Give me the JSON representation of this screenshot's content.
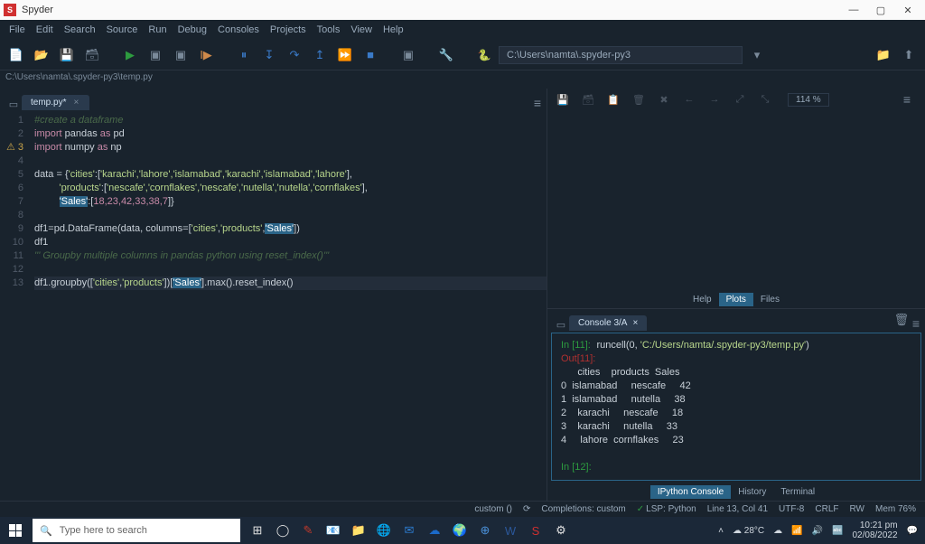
{
  "window": {
    "title": "Spyder",
    "min": "—",
    "max": "▢",
    "close": "✕"
  },
  "menu": [
    "File",
    "Edit",
    "Search",
    "Source",
    "Run",
    "Debug",
    "Consoles",
    "Projects",
    "Tools",
    "View",
    "Help"
  ],
  "path_input": "C:\\Users\\namta\\.spyder-py3",
  "breadcrumb": "C:\\Users\\namta\\.spyder-py3\\temp.py",
  "editor_tab": {
    "name": "temp.py*",
    "close": "×"
  },
  "gutter_lines": [
    "1",
    "2",
    "3",
    "4",
    "5",
    "6",
    "7",
    "8",
    "9",
    "10",
    "11",
    "12",
    "13"
  ],
  "code": {
    "l1": "#create a dataframe",
    "l2_import": "import",
    "l2_pandas": "pandas",
    "l2_as": "as",
    "l2_pd": "pd",
    "l3_import": "import",
    "l3_numpy": "numpy",
    "l3_as": "as",
    "l3_np": "np",
    "l5_pre": "data = {",
    "l5_cities": "'cities'",
    "l5_colon": ":[",
    "l5_v": "'karachi','lahore','islamabad','karachi','islamabad','lahore'",
    "l5_end": "],",
    "l6_pre": "         ",
    "l6_prod": "'products'",
    "l6_colon": ":[",
    "l6_v": "'nescafe','cornflakes','nescafe','nutella','nutella','cornflakes'",
    "l6_end": "],",
    "l7_pre": "         ",
    "l7_sales": "'Sales'",
    "l7_colon": ":[",
    "l7_nums": "18,23,42,33,38,7",
    "l7_end": "]}",
    "l9_pre": "df1=pd.DataFrame(data, columns=[",
    "l9_c1": "'cities'",
    "l9_c2": "'products'",
    "l9_c3": "'Sales'",
    "l9_end": "])",
    "l10": "df1",
    "l11": "''' Groupby multiple columns in pandas python using reset_index()'''",
    "l13_pre": "df1.groupby([",
    "l13_c1": "'cities'",
    "l13_c2": "'products'",
    "l13_mid": "])[",
    "l13_sales": "'Sales'",
    "l13_end": "].max().reset_index()"
  },
  "rt_toolbar": {
    "zoom": "114 %",
    "icons": [
      "save",
      "home",
      "refresh",
      "delete",
      "cut",
      "back",
      "fwd",
      "undo",
      "redo"
    ]
  },
  "rt_tabs": {
    "help": "Help",
    "plots": "Plots",
    "files": "Files"
  },
  "console_tab": {
    "name": "Console 3/A",
    "close": "×"
  },
  "console": {
    "in_prompt": "In [11]:",
    "in_call": "runcell(",
    "in_zero": "0",
    "in_comma": ", ",
    "in_path": "'C:/Users/namta/.spyder-py3/temp.py'",
    "in_cparen": ")",
    "out_prompt": "Out[11]:",
    "header": "      cities    products  Sales",
    "r0": "0  islamabad     nescafe     42",
    "r1": "1  islamabad     nutella     38",
    "r2": "2    karachi     nescafe     18",
    "r3": "3    karachi     nutella     33",
    "r4": "4     lahore  cornflakes     23",
    "blank": "",
    "next": "In [12]:"
  },
  "rb_tabs": {
    "ip": "IPython Console",
    "hist": "History",
    "term": "Terminal"
  },
  "status": {
    "custom": "custom ()",
    "completions": "Completions: custom",
    "lsp": "LSP: Python",
    "pos": "Line 13, Col 41",
    "enc": "UTF-8",
    "eol": "CRLF",
    "rw": "RW",
    "mem": "Mem 76%",
    "refresh": "⟳"
  },
  "taskbar": {
    "search_placeholder": "Type here to search",
    "temp": "28°C",
    "time": "10:21 pm",
    "date": "02/08/2022"
  }
}
